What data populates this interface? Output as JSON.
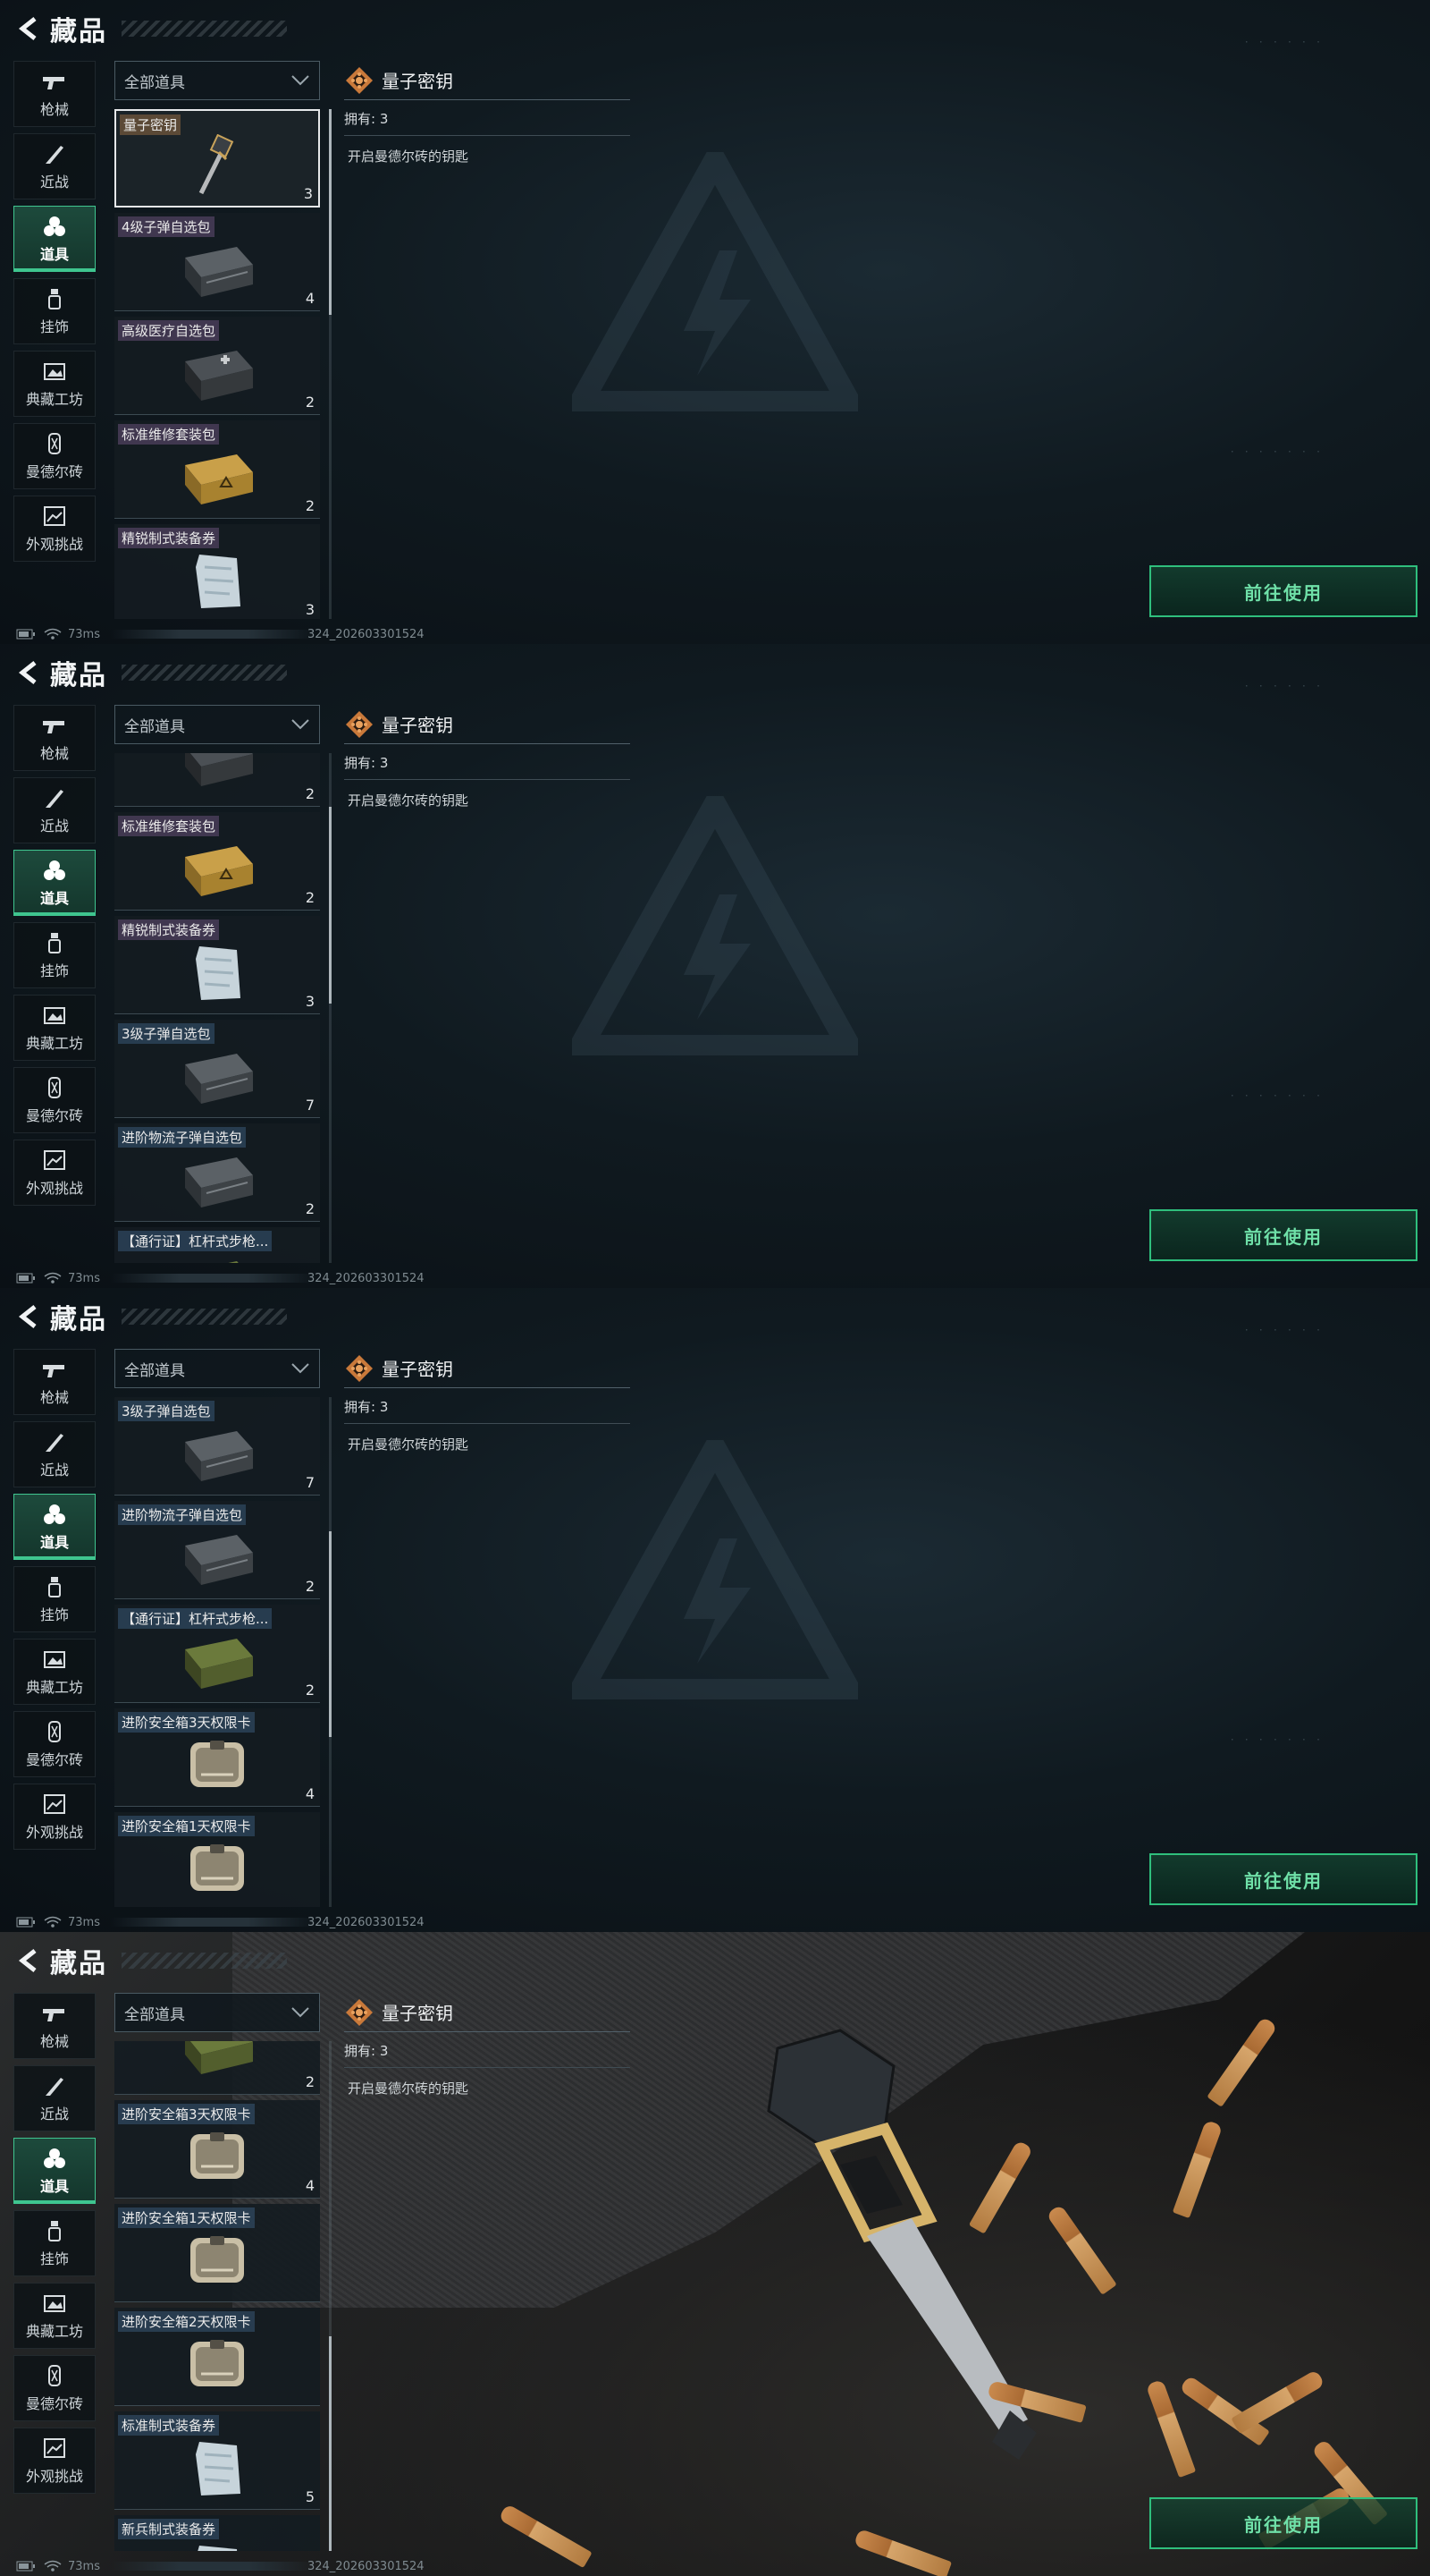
{
  "header": {
    "title": "藏品"
  },
  "sidebar": {
    "items": [
      {
        "label": "枪械",
        "icon": "gun-icon"
      },
      {
        "label": "近战",
        "icon": "knife-icon"
      },
      {
        "label": "道具",
        "icon": "items-icon",
        "active": true
      },
      {
        "label": "挂饰",
        "icon": "charm-icon"
      },
      {
        "label": "典藏工坊",
        "icon": "workshop-icon"
      },
      {
        "label": "曼德尔砖",
        "icon": "brick-icon"
      },
      {
        "label": "外观挑战",
        "icon": "challenge-icon"
      }
    ]
  },
  "filter": {
    "selected": "全部道具"
  },
  "detail": {
    "name": "量子密钥",
    "own": "拥有: 3",
    "desc": "开启曼德尔砖的钥匙"
  },
  "use_button": {
    "label": "前往使用"
  },
  "status": {
    "ping": "73ms",
    "build": "324_202603301524"
  },
  "colors": {
    "accent": "#3fc58f",
    "button_text": "#6fe0a8",
    "background": "#101a20"
  },
  "panels": [
    {
      "list": [
        {
          "name": "量子密钥",
          "count": "3",
          "img": "key",
          "tag": "gold",
          "selected": true
        },
        {
          "name": "4级子弹自选包",
          "count": "4",
          "img": "ammo-box-dark",
          "tag": "purple"
        },
        {
          "name": "高级医疗自选包",
          "count": "2",
          "img": "medic-box",
          "tag": "purple"
        },
        {
          "name": "标准维修套装包",
          "count": "2",
          "img": "repair-box",
          "tag": "purple"
        },
        {
          "name": "精锐制式装备券",
          "count": "3",
          "img": "voucher",
          "tag": "purple"
        }
      ]
    },
    {
      "list": [
        {
          "name": "",
          "count": "2",
          "img": "medic-box",
          "tag": "none",
          "partial": true
        },
        {
          "name": "标准维修套装包",
          "count": "2",
          "img": "repair-box",
          "tag": "purple"
        },
        {
          "name": "精锐制式装备券",
          "count": "3",
          "img": "voucher",
          "tag": "purple"
        },
        {
          "name": "3级子弹自选包",
          "count": "7",
          "img": "ammo-box-dark",
          "tag": "blue"
        },
        {
          "name": "进阶物流子弹自选包",
          "count": "2",
          "img": "ammo-box-dark",
          "tag": "blue"
        },
        {
          "name": "【通行证】杠杆式步枪...",
          "count": "",
          "img": "green-crate",
          "tag": "blue"
        }
      ]
    },
    {
      "list": [
        {
          "name": "3级子弹自选包",
          "count": "7",
          "img": "ammo-box-dark",
          "tag": "blue"
        },
        {
          "name": "进阶物流子弹自选包",
          "count": "2",
          "img": "ammo-box-dark",
          "tag": "blue"
        },
        {
          "name": "【通行证】杠杆式步枪...",
          "count": "2",
          "img": "green-crate",
          "tag": "blue"
        },
        {
          "name": "进阶安全箱3天权限卡",
          "count": "4",
          "img": "safe-card",
          "tag": "blue"
        },
        {
          "name": "进阶安全箱1天权限卡",
          "count": "",
          "img": "safe-card",
          "tag": "blue"
        }
      ]
    },
    {
      "list": [
        {
          "name": "",
          "count": "2",
          "img": "green-crate",
          "tag": "none",
          "partial": true
        },
        {
          "name": "进阶安全箱3天权限卡",
          "count": "4",
          "img": "safe-card",
          "tag": "blue"
        },
        {
          "name": "进阶安全箱1天权限卡",
          "count": "",
          "img": "safe-card",
          "tag": "blue"
        },
        {
          "name": "进阶安全箱2天权限卡",
          "count": "",
          "img": "safe-card",
          "tag": "blue"
        },
        {
          "name": "标准制式装备券",
          "count": "5",
          "img": "voucher",
          "tag": "blue"
        },
        {
          "name": "新兵制式装备券",
          "count": "",
          "img": "voucher",
          "tag": "blue"
        }
      ]
    }
  ]
}
